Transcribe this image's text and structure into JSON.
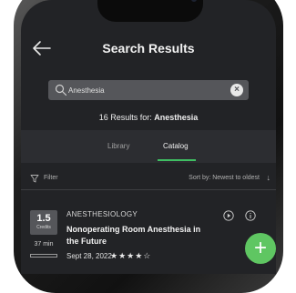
{
  "header": {
    "title": "Search Results",
    "back_icon": "arrow-left-icon"
  },
  "search": {
    "value": "Anesthesia",
    "icon": "search-icon",
    "clear_icon": "clear-icon"
  },
  "results": {
    "prefix": "16 Results for: ",
    "query": "Anesthesia"
  },
  "tabs": [
    {
      "label": "Library",
      "active": false
    },
    {
      "label": "Catalog",
      "active": true
    }
  ],
  "filter": {
    "label": "Filter",
    "sort_label": "Sort by: Newest to oldest",
    "sort_arrow": "↓"
  },
  "course": {
    "credits": "1.5",
    "credits_label": "Credits",
    "duration": "37 min",
    "category": "ANESTHESIOLOGY",
    "title": "Nonoperating Room Anesthesia in the Future",
    "date": "Sept 28, 2022",
    "rating_stars": "★★★★☆",
    "rating": 4,
    "rating_max": 5
  },
  "fab": {
    "label": "+"
  },
  "colors": {
    "accent": "#3fbf62",
    "fab": "#5fc662",
    "background": "#222326",
    "search_bg": "#55565a"
  }
}
